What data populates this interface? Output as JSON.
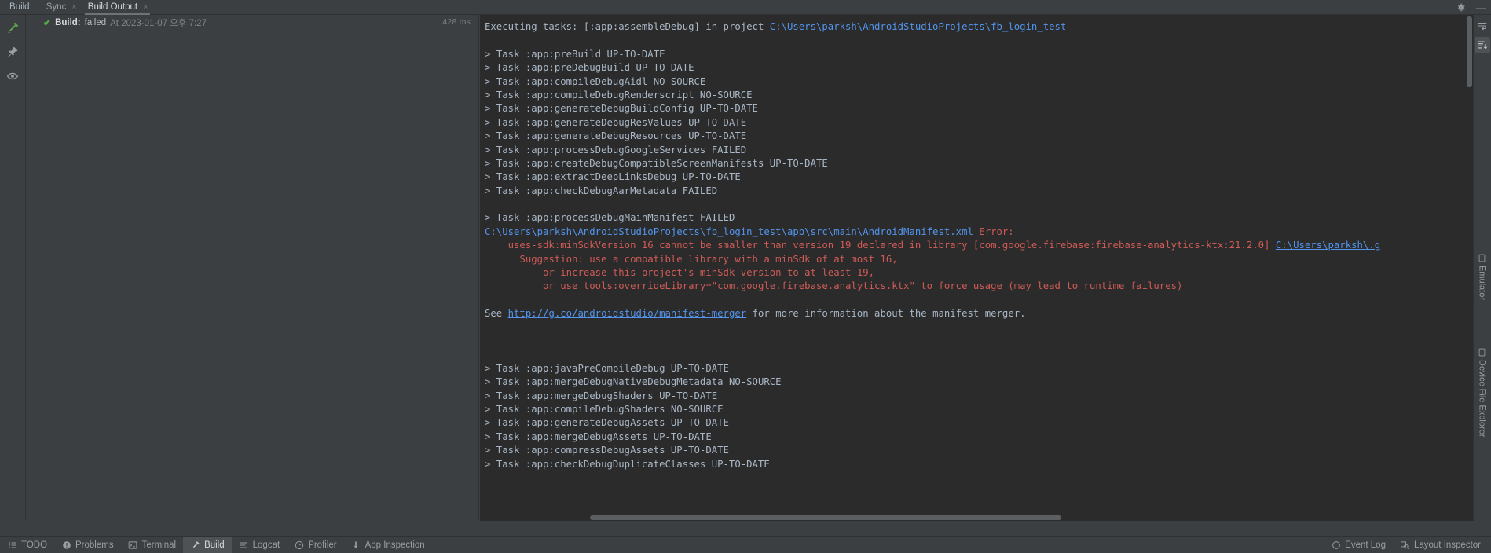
{
  "window": {
    "title_label": "Build:",
    "minimize_glyph": "—",
    "settings_icon": "gear-icon",
    "collapse_icon": "collapse-icon"
  },
  "tabs": [
    {
      "label": "Sync",
      "close": "×",
      "active": false
    },
    {
      "label": "Build Output",
      "close": "×",
      "active": true
    }
  ],
  "left_rail": [
    {
      "name": "build-hammer-icon",
      "title": "Build"
    },
    {
      "name": "pin-icon",
      "title": "Pin Tab"
    },
    {
      "name": "eye-icon",
      "title": "Toggle View"
    }
  ],
  "tree": {
    "status_check": "✔",
    "build_label": "Build:",
    "build_result": "failed",
    "build_time": "At 2023-01-07 오후 7:27",
    "duration": "428 ms"
  },
  "console": {
    "lines": [
      {
        "segs": [
          {
            "t": "Executing tasks: [:app:assembleDebug] in project ",
            "c": "plain"
          },
          {
            "t": "C:\\Users\\parksh\\AndroidStudioProjects\\fb_login_test",
            "c": "link"
          }
        ]
      },
      {
        "segs": [
          {
            "t": "",
            "c": "plain"
          }
        ]
      },
      {
        "segs": [
          {
            "t": "> Task :app:preBuild UP-TO-DATE",
            "c": "plain"
          }
        ]
      },
      {
        "segs": [
          {
            "t": "> Task :app:preDebugBuild UP-TO-DATE",
            "c": "plain"
          }
        ]
      },
      {
        "segs": [
          {
            "t": "> Task :app:compileDebugAidl NO-SOURCE",
            "c": "plain"
          }
        ]
      },
      {
        "segs": [
          {
            "t": "> Task :app:compileDebugRenderscript NO-SOURCE",
            "c": "plain"
          }
        ]
      },
      {
        "segs": [
          {
            "t": "> Task :app:generateDebugBuildConfig UP-TO-DATE",
            "c": "plain"
          }
        ]
      },
      {
        "segs": [
          {
            "t": "> Task :app:generateDebugResValues UP-TO-DATE",
            "c": "plain"
          }
        ]
      },
      {
        "segs": [
          {
            "t": "> Task :app:generateDebugResources UP-TO-DATE",
            "c": "plain"
          }
        ]
      },
      {
        "segs": [
          {
            "t": "> Task :app:processDebugGoogleServices FAILED",
            "c": "plain"
          }
        ]
      },
      {
        "segs": [
          {
            "t": "> Task :app:createDebugCompatibleScreenManifests UP-TO-DATE",
            "c": "plain"
          }
        ]
      },
      {
        "segs": [
          {
            "t": "> Task :app:extractDeepLinksDebug UP-TO-DATE",
            "c": "plain"
          }
        ]
      },
      {
        "segs": [
          {
            "t": "> Task :app:checkDebugAarMetadata FAILED",
            "c": "plain"
          }
        ]
      },
      {
        "segs": [
          {
            "t": "",
            "c": "plain"
          }
        ]
      },
      {
        "segs": [
          {
            "t": "> Task :app:processDebugMainManifest FAILED",
            "c": "plain"
          }
        ]
      },
      {
        "segs": [
          {
            "t": "C:\\Users\\parksh\\AndroidStudioProjects\\fb_login_test\\app\\src\\main\\AndroidManifest.xml",
            "c": "link"
          },
          {
            "t": " Error:",
            "c": "err"
          }
        ]
      },
      {
        "segs": [
          {
            "t": "    uses-sdk:minSdkVersion 16 cannot be smaller than version 19 declared in library [com.google.firebase:firebase-analytics-ktx:21.2.0] ",
            "c": "err"
          },
          {
            "t": "C:\\Users\\parksh\\.g",
            "c": "link"
          }
        ]
      },
      {
        "segs": [
          {
            "t": "      Suggestion: use a compatible library with a minSdk of at most 16,",
            "c": "err"
          }
        ]
      },
      {
        "segs": [
          {
            "t": "          or increase this project's minSdk version to at least 19,",
            "c": "err"
          }
        ]
      },
      {
        "segs": [
          {
            "t": "          or use tools:overrideLibrary=\"com.google.firebase.analytics.ktx\" to force usage (may lead to runtime failures)",
            "c": "err"
          }
        ]
      },
      {
        "segs": [
          {
            "t": "",
            "c": "plain"
          }
        ]
      },
      {
        "segs": [
          {
            "t": "See ",
            "c": "plain"
          },
          {
            "t": "http://g.co/androidstudio/manifest-merger",
            "c": "link"
          },
          {
            "t": " for more information about the manifest merger.",
            "c": "plain"
          }
        ]
      },
      {
        "segs": [
          {
            "t": "",
            "c": "plain"
          }
        ]
      },
      {
        "segs": [
          {
            "t": "",
            "c": "plain"
          }
        ]
      },
      {
        "segs": [
          {
            "t": "",
            "c": "plain"
          }
        ]
      },
      {
        "segs": [
          {
            "t": "> Task :app:javaPreCompileDebug UP-TO-DATE",
            "c": "plain"
          }
        ]
      },
      {
        "segs": [
          {
            "t": "> Task :app:mergeDebugNativeDebugMetadata NO-SOURCE",
            "c": "plain"
          }
        ]
      },
      {
        "segs": [
          {
            "t": "> Task :app:mergeDebugShaders UP-TO-DATE",
            "c": "plain"
          }
        ]
      },
      {
        "segs": [
          {
            "t": "> Task :app:compileDebugShaders NO-SOURCE",
            "c": "plain"
          }
        ]
      },
      {
        "segs": [
          {
            "t": "> Task :app:generateDebugAssets UP-TO-DATE",
            "c": "plain"
          }
        ]
      },
      {
        "segs": [
          {
            "t": "> Task :app:mergeDebugAssets UP-TO-DATE",
            "c": "plain"
          }
        ]
      },
      {
        "segs": [
          {
            "t": "> Task :app:compressDebugAssets UP-TO-DATE",
            "c": "plain"
          }
        ]
      },
      {
        "segs": [
          {
            "t": "> Task :app:checkDebugDuplicateClasses UP-TO-DATE",
            "c": "plain"
          }
        ]
      }
    ]
  },
  "right_rail": {
    "icons": [
      {
        "name": "soft-wrap-icon",
        "selected": false
      },
      {
        "name": "scroll-to-end-icon",
        "selected": true
      }
    ],
    "vertical_tabs": [
      {
        "label": "Emulator",
        "icon": "emulator-icon"
      },
      {
        "label": "Device File Explorer",
        "icon": "device-file-explorer-icon"
      }
    ]
  },
  "statusbar": {
    "left_items": [
      {
        "label": "TODO",
        "icon": "list-icon",
        "active": false
      },
      {
        "label": "Problems",
        "icon": "warning-icon",
        "active": false
      },
      {
        "label": "Terminal",
        "icon": "terminal-icon",
        "active": false
      },
      {
        "label": "Build",
        "icon": "hammer-icon",
        "active": true
      },
      {
        "label": "Logcat",
        "icon": "logcat-icon",
        "active": false
      },
      {
        "label": "Profiler",
        "icon": "profiler-icon",
        "active": false
      },
      {
        "label": "App Inspection",
        "icon": "inspection-icon",
        "active": false
      }
    ],
    "right_items": [
      {
        "label": "Event Log",
        "icon": "event-log-icon"
      },
      {
        "label": "Layout Inspector",
        "icon": "layout-inspector-icon"
      }
    ]
  },
  "colors": {
    "chrome": "#3c3f41",
    "console_bg": "#2b2b2b",
    "text": "#a9b7c6",
    "error": "#cf5b56",
    "link": "#5394ec",
    "success": "#56a84b"
  }
}
